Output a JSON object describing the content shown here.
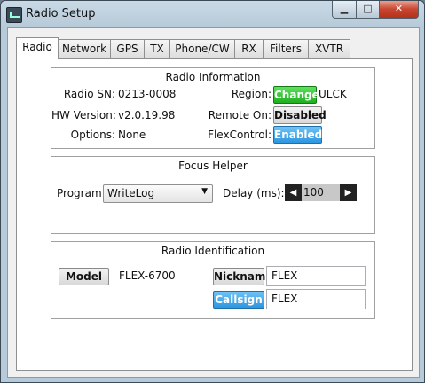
{
  "window": {
    "title": "Radio Setup",
    "minimize_glyph": "▁",
    "maximize_glyph": "□",
    "close_glyph": "✕"
  },
  "tabs": [
    "Radio",
    "Network",
    "GPS",
    "TX",
    "Phone/CW",
    "RX",
    "Filters",
    "XVTR"
  ],
  "radio_info": {
    "title": "Radio Information",
    "sn_label": "Radio SN:",
    "sn_value": "0213-0008",
    "hw_label": "HW Version:",
    "hw_value": "v2.0.19.98",
    "options_label": "Options:",
    "options_value": "None",
    "region_label": "Region:",
    "region_button": "Change",
    "region_value": "ULCK",
    "remote_label": "Remote On:",
    "remote_button": "Disabled",
    "flex_label": "FlexControl:",
    "flex_button": "Enabled"
  },
  "focus_helper": {
    "title": "Focus Helper",
    "program_label": "Program:",
    "program_value": "WriteLog",
    "delay_label": "Delay (ms):",
    "delay_value": "100"
  },
  "radio_id": {
    "title": "Radio Identification",
    "model_button": "Model",
    "model_value": "FLEX-6700",
    "nickname_button": "Nickname",
    "nickname_value": "FLEX",
    "callsign_button": "Callsign",
    "callsign_value": "FLEX"
  },
  "colors": {
    "green": "#1fae1f",
    "blue": "#2d96e0",
    "close": "#c8452f"
  }
}
